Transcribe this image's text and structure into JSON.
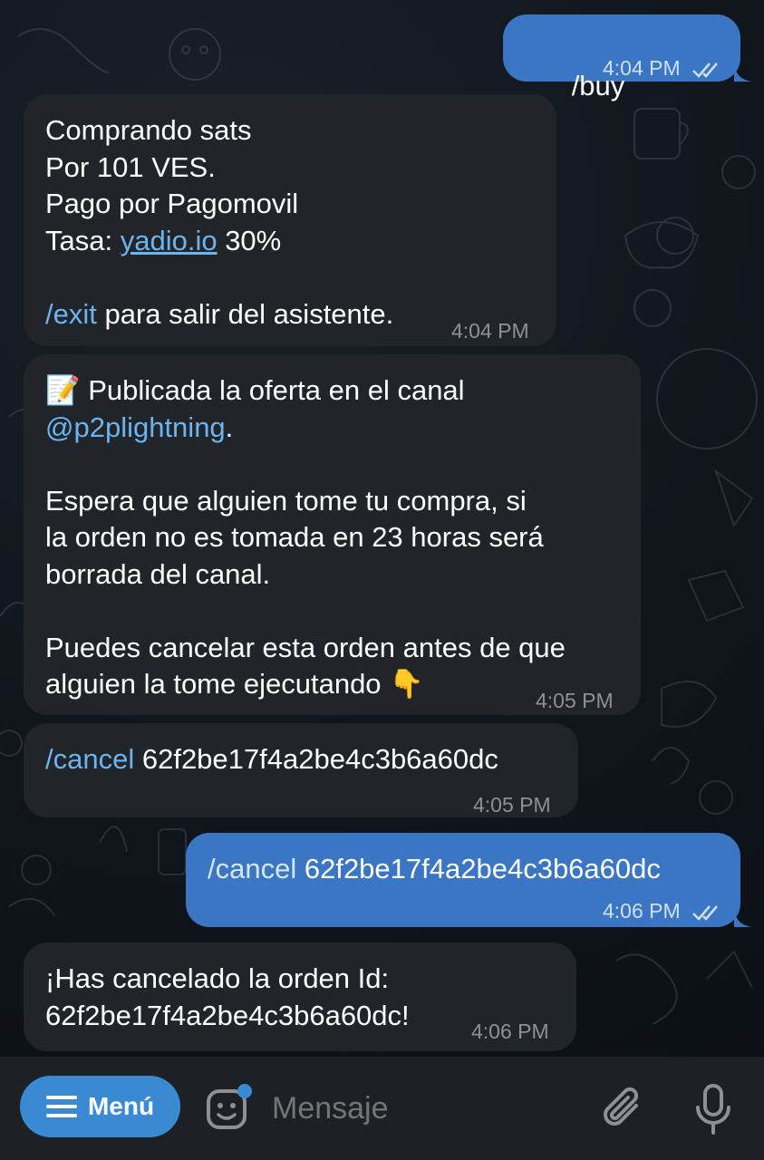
{
  "messages": [
    {
      "direction": "outgoing",
      "command": "/buy",
      "time": "4:04 PM",
      "status": "read-double-check-icon"
    },
    {
      "direction": "incoming",
      "lines": [
        "Comprando sats",
        "Por 101 VES.",
        "Pago por Pagomovil"
      ],
      "rate_prefix": "Tasa: ",
      "rate_link": "yadio.io",
      "rate_suffix": " 30%",
      "exit_command": "/exit",
      "exit_text": " para salir del asistente.",
      "time": "4:04 PM"
    },
    {
      "direction": "incoming",
      "memo_icon": "📝",
      "intro": " Publicada la oferta en el canal",
      "channel": "@p2plightning",
      "channel_suffix": ".",
      "para2": [
        "Espera que alguien tome tu compra, si",
        "la orden no es tomada en 23 horas será",
        "borrada del canal."
      ],
      "para3": [
        "Puedes cancelar esta orden antes de que",
        "alguien la tome ejecutando "
      ],
      "pointing_icon": "👇",
      "time": "4:05 PM"
    },
    {
      "direction": "incoming",
      "command": "/cancel",
      "order_id": " 62f2be17f4a2be4c3b6a60dc",
      "time": "4:05 PM"
    },
    {
      "direction": "outgoing",
      "command": "/cancel",
      "order_id": " 62f2be17f4a2be4c3b6a60dc",
      "time": "4:06 PM",
      "status": "read-double-check-icon"
    },
    {
      "direction": "incoming",
      "lines": [
        "¡Has cancelado la orden Id:",
        "62f2be17f4a2be4c3b6a60dc!"
      ],
      "time": "4:06 PM"
    }
  ],
  "input_bar": {
    "menu_label": "Menú",
    "placeholder": "Mensaje",
    "icons": [
      "menu-lines-icon",
      "sticker-icon",
      "paperclip-icon",
      "microphone-icon"
    ]
  },
  "colors": {
    "incoming_bubble": "#212529",
    "outgoing_bubble": "#3a76c3",
    "link": "#6cb4f0",
    "menu_button": "#3a8ad3",
    "input_bar": "#1d2125",
    "background": "#0e1621"
  }
}
